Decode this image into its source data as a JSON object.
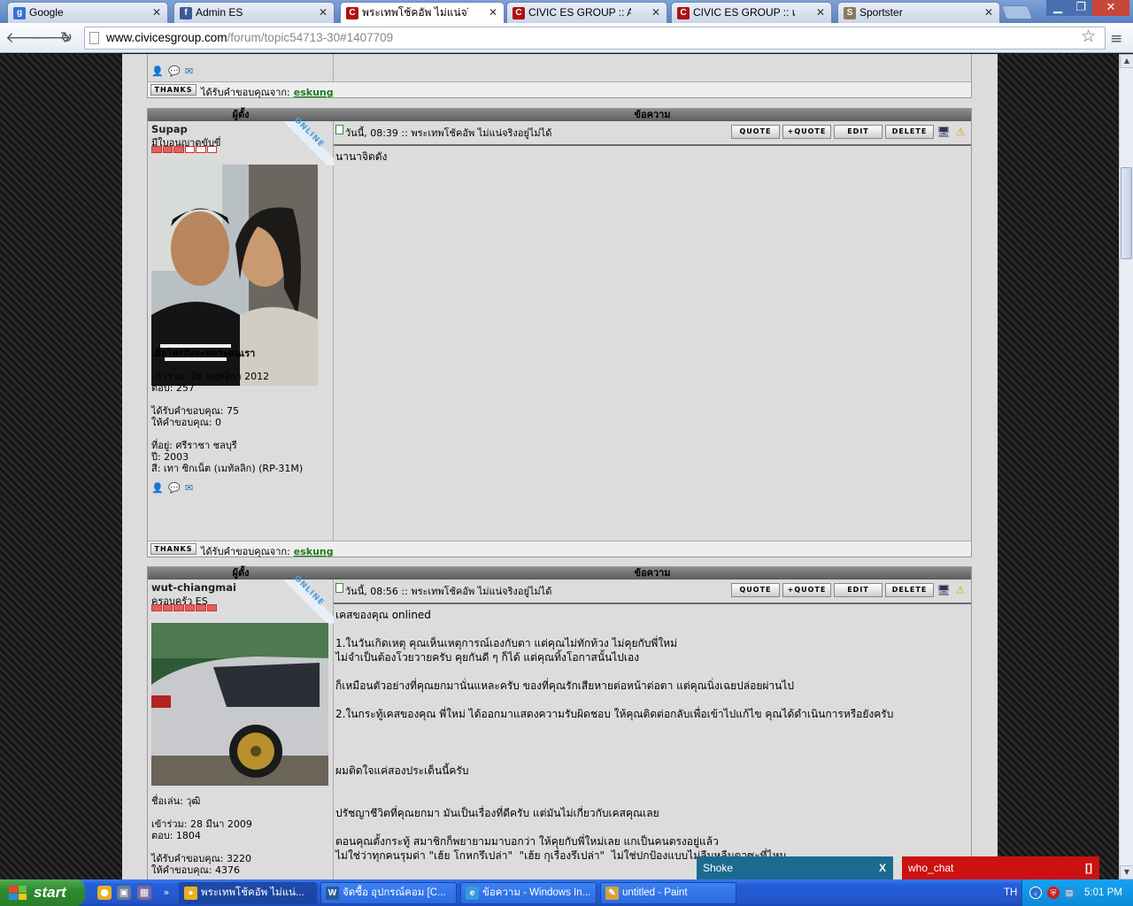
{
  "browser": {
    "tabs": [
      {
        "label": "Google",
        "icon": "google-icon",
        "color": "#3b6fd8",
        "glyph": "g"
      },
      {
        "label": "Admin ES",
        "icon": "facebook-icon",
        "color": "#3b5998",
        "glyph": "f"
      },
      {
        "label": "พระเทพโช้คอัพ ไม่แน่จริงอยู่ไม่ได้",
        "icon": "civic-es-icon",
        "color": "#b01010",
        "glyph": "C"
      },
      {
        "label": "CIVIC ES GROUP :: Admin ::",
        "icon": "civic-es-icon",
        "color": "#b01010",
        "glyph": "C"
      },
      {
        "label": "CIVIC ES GROUP :: เว็บบอร์ด",
        "icon": "civic-es-icon",
        "color": "#b01010",
        "glyph": "C"
      },
      {
        "label": "Sportster",
        "icon": "sportster-icon",
        "color": "#8a7a5a",
        "glyph": "S"
      }
    ],
    "url_host": "www.civicesgroup.com",
    "url_path": "/forum/topic54713-30#1407709"
  },
  "headers": {
    "author": "ผู้ตั้ง",
    "message": "ข้อความ"
  },
  "buttons": {
    "quote": "QUOTE",
    "mquote": "+QUOTE",
    "edit": "EDIT",
    "delete": "DELETE",
    "thanks": "THANKS"
  },
  "thanks_label": "ได้รับคำขอบคุณจาก:",
  "prev_post": {
    "thanked_by": "eskung"
  },
  "posts": [
    {
      "username": "Supap",
      "rank": "มีใบอนุญาตขับขี่",
      "status": "ONLINE",
      "stars_on": 3,
      "signature": "เมื่อไหร่ถึงจะพอวะคนเรา",
      "joined": "เข้าร่วม: 26 พฤศจิกา 2012",
      "posts_count": "ตอบ: 257",
      "thanks_received": "ได้รับคำขอบคุณ: 75",
      "thanks_given": "ให้คำขอบคุณ: 0",
      "location": "ที่อยู่: ศรีราชา ชลบุรี",
      "year": "ปี: 2003",
      "car_color": "สี: เทา ซิกเน็ต (เมทัลลิก) (RP-31M)",
      "post_meta": "วันนี้, 08:39 :: พระเทพโช้คอัพ ไม่แน่จริงอยู่ไม่ได้",
      "body": [
        "นานาจิตตัง"
      ],
      "thanked_by": "eskung"
    },
    {
      "username": "wut-chiangmai",
      "rank": "ครอบครัว ES",
      "status": "ONLINE",
      "stars_on": 6,
      "nickname": "ชื่อเล่น: วุฒิ",
      "joined": "เข้าร่วม: 28 มีนา 2009",
      "posts_count": "ตอบ: 1804",
      "thanks_received": "ได้รับคำขอบคุณ: 3220",
      "thanks_given": "ให้คำขอบคุณ: 4376",
      "post_meta": "วันนี้, 08:56 :: พระเทพโช้คอัพ ไม่แน่จริงอยู่ไม่ได้",
      "body": [
        "เคสของคุณ onlined",
        "",
        "1.ในวันเกิดเหตุ คุณเห็นเหตุการณ์เองกับตา แต่คุณไม่ทักท้วง ไม่คุยกับพี่ใหม่",
        "ไม่จำเป็นต้องโวยวายครับ คุยกันดี ๆ ก็ได้ แต่คุณทิ้งโอกาสนั้นไปเอง",
        "",
        "ก็เหมือนตัวอย่างที่คุณยกมานั่นแหละครับ ของที่คุณรักเสียหายต่อหน้าต่อตา แต่คุณนิ่งเฉยปล่อยผ่านไป",
        "",
        "2.ในกระทู้เคสของคุณ พี่ใหม่ ได้ออกมาแสดงความรับผิดชอบ ให้คุณติดต่อกลับเพื่อเข้าไปแก้ไข คุณได้ดำเนินการหรือยังครับ",
        "",
        "",
        "",
        "ผมติดใจแค่สองประเด็นนี้ครับ",
        "",
        "",
        "ปรัชญาชีวิตที่คุณยกมา มันเป็นเรื่องที่ดีครับ แต่มันไม่เกี่ยวกับเคสคุณเลย",
        "",
        "ตอนคุณตั้งกระทู้ สมาชิกก็พยายามมาบอกว่า ให้คุยกับพี่ใหม่เลย แกเป็นคนตรงอยู่แล้ว",
        "ไม่ใช่ว่าทุกคนรุมด่า \"เฮ้ย โกหกรึเปล่า\"  \"เฮ้ย กุเรื่องรึเปล่า\"  ไม่ใช่ปกป้องแบบไม่ลืมหูลืมตาซะที่ไหน"
      ]
    }
  ],
  "chat": {
    "shoke_label": "Shoke",
    "shoke_close": "X",
    "who_label": "who_chat",
    "who_close": "[]",
    "shoke_color": "#1c6a90",
    "who_color": "#cc1111"
  },
  "taskbar": {
    "start": "start",
    "tasks": [
      {
        "label": "พระเทพโช้คอัพ ไม่แน่...",
        "icon": "chrome-icon",
        "glyph": "●",
        "color": "#e8b020"
      },
      {
        "label": "จัดซื้อ อุปกรณ์คอม [C...",
        "icon": "word-icon",
        "glyph": "W",
        "color": "#2b579a"
      },
      {
        "label": "ข้อความ - Windows In...",
        "icon": "ie-icon",
        "glyph": "e",
        "color": "#3a9ad9"
      },
      {
        "label": "untitled - Paint",
        "icon": "paint-icon",
        "glyph": "✎",
        "color": "#d8a040"
      }
    ],
    "lang": "TH",
    "time": "5:01 PM"
  }
}
